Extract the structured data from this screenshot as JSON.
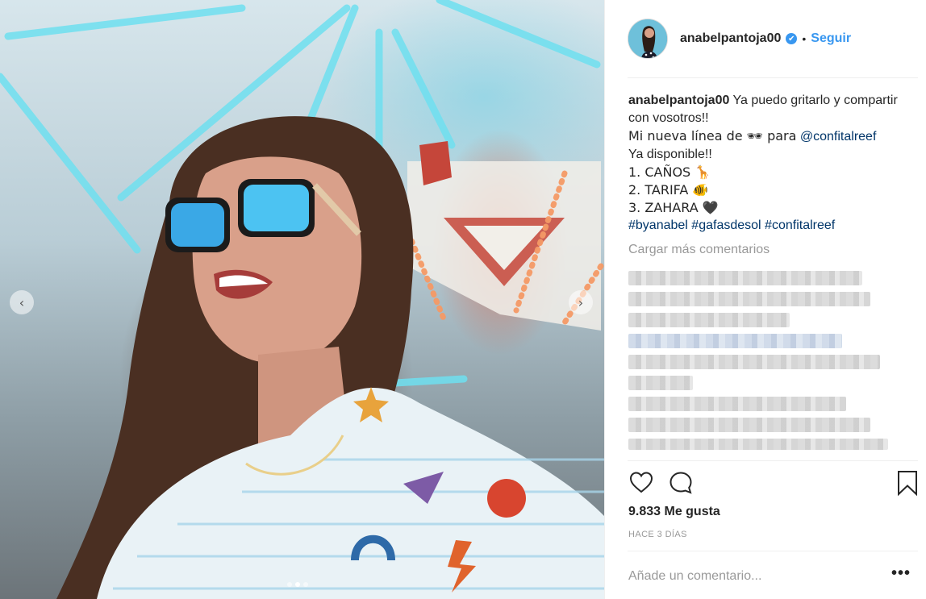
{
  "post": {
    "photo_alt": "",
    "carousel": {
      "dot_count": 3,
      "active_dot": 2
    }
  },
  "header": {
    "username": "anabelpantoja00",
    "verified_glyph": "✔",
    "separator": "•",
    "follow_label": "Seguir"
  },
  "caption": {
    "username": "anabelpantoja00",
    "line1": "Ya puedo gritarlo y compartir con vosotros!!",
    "line2_pre": "Mi nueva línea de 🕶 para",
    "line2_mention": "@confitalreef",
    "line3": "Ya disponible!!",
    "line4": "1. CAÑOS 🦒",
    "line5": "2. TARIFA 🐠",
    "line6": "3. ZAHARA 🖤",
    "hashtag1": "#byanabel",
    "hashtag2": "#gafasdesol",
    "hashtag3": "#confitalreef"
  },
  "comments": {
    "load_more_label": "Cargar más comentarios"
  },
  "actions": {
    "like_icon": "heart-icon",
    "comment_icon": "comment-bubble-icon",
    "save_icon": "bookmark-icon"
  },
  "stats": {
    "likes": "9.833 Me gusta",
    "timestamp": "HACE 3 DÍAS"
  },
  "composer": {
    "placeholder": "Añade un comentario...",
    "more_label": "•••"
  },
  "colors": {
    "accent": "#3897f0",
    "text": "#262626",
    "muted": "#999999",
    "mention": "#003569"
  }
}
